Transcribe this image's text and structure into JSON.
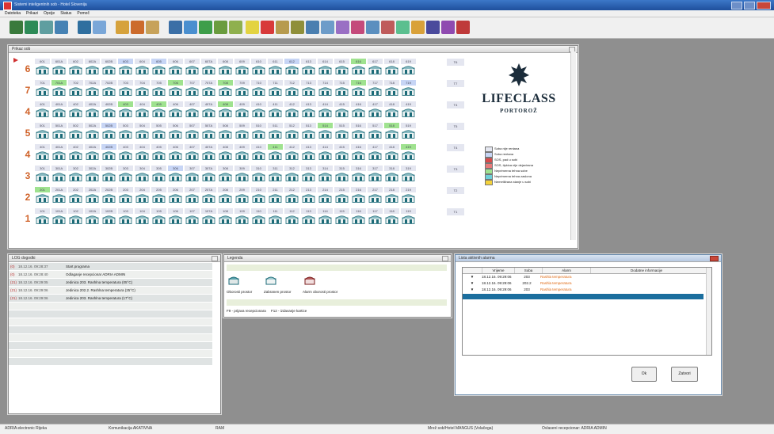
{
  "window": {
    "title": "Sistemi inteligentnih sob - Hotel Slovenija",
    "subtitle": "Prikaz sob"
  },
  "menu": [
    "Datoteka",
    "Prikazi",
    "Opcije",
    "Status",
    "Pomoč"
  ],
  "rooms_window": {
    "title": "Prikaz sob"
  },
  "floors": [
    {
      "label": "6",
      "rooms": [
        "601",
        "601A",
        "602",
        "602A",
        "602B",
        "603",
        "604",
        "605",
        "606",
        "607",
        "607A",
        "608",
        "609",
        "610",
        "611",
        "612",
        "613",
        "614",
        "615",
        "616",
        "617",
        "618",
        "619"
      ],
      "highlight": {
        "603": "#c7d5f5",
        "605": "#c7d5f5",
        "612": "#c7d5f5",
        "616": "#9fe28f"
      },
      "side": "T6"
    },
    {
      "label": "7",
      "rooms": [
        "701",
        "701A",
        "702",
        "702A",
        "702B",
        "703",
        "704",
        "705",
        "706",
        "707",
        "707A",
        "708",
        "709",
        "710",
        "711",
        "712",
        "713",
        "714",
        "715",
        "716",
        "717",
        "718",
        "719"
      ],
      "highlight": {
        "701A": "#9fe28f",
        "706": "#9fe28f",
        "708": "#9fe28f",
        "716": "#9fe28f",
        "719": "#c7d5f5"
      },
      "side": "T7"
    },
    {
      "label": "4",
      "rooms": [
        "401",
        "401A",
        "402",
        "402A",
        "402B",
        "403",
        "404",
        "405",
        "406",
        "407",
        "407A",
        "408",
        "409",
        "410",
        "411",
        "412",
        "413",
        "414",
        "415",
        "416",
        "417",
        "418",
        "419"
      ],
      "highlight": {
        "403": "#9fe28f",
        "405": "#9fe28f",
        "408": "#9fe28f"
      },
      "side": "T4"
    },
    {
      "label": "5",
      "rooms": [
        "501",
        "501A",
        "502",
        "502A",
        "502B",
        "503",
        "504",
        "505",
        "506",
        "507",
        "507A",
        "508",
        "509",
        "510",
        "511",
        "512",
        "513",
        "514",
        "515",
        "516",
        "517",
        "518",
        "519"
      ],
      "highlight": {
        "502B": "#c7d5f5",
        "514": "#9fe28f",
        "518": "#9fe28f"
      },
      "side": "T5"
    },
    {
      "label": "4",
      "rooms": [
        "401",
        "401A",
        "402",
        "402A",
        "402B",
        "403",
        "404",
        "405",
        "406",
        "407",
        "407A",
        "408",
        "409",
        "410",
        "411",
        "412",
        "413",
        "414",
        "415",
        "416",
        "417",
        "418",
        "419"
      ],
      "highlight": {
        "402B": "#c7d5f5",
        "411": "#9fe28f",
        "419": "#9fe28f"
      },
      "side": "T4"
    },
    {
      "label": "3",
      "rooms": [
        "301",
        "301A",
        "302",
        "302A",
        "302B",
        "303",
        "304",
        "305",
        "306",
        "307",
        "307A",
        "308",
        "309",
        "310",
        "311",
        "312",
        "313",
        "314",
        "315",
        "316",
        "317",
        "318",
        "319"
      ],
      "highlight": {
        "306": "#c7d5f5"
      },
      "side": "T3"
    },
    {
      "label": "2",
      "rooms": [
        "201",
        "201A",
        "202",
        "202A",
        "202B",
        "203",
        "204",
        "205",
        "206",
        "207",
        "207A",
        "208",
        "209",
        "210",
        "211",
        "212",
        "213",
        "214",
        "215",
        "216",
        "217",
        "218",
        "219"
      ],
      "highlight": {
        "201": "#9fe28f"
      },
      "side": "T2"
    },
    {
      "label": "1",
      "rooms": [
        "101",
        "101A",
        "102",
        "102A",
        "102B",
        "103",
        "104",
        "105",
        "106",
        "107",
        "107A",
        "108",
        "109",
        "110",
        "111",
        "112",
        "113",
        "114",
        "115",
        "116",
        "117",
        "118",
        "119"
      ],
      "highlight": {},
      "side": "T1"
    }
  ],
  "logo": {
    "name": "LIFECLASS",
    "place": "PORTOROŽ"
  },
  "legend_items": [
    {
      "color": "#e4e6f0",
      "text": "Soba nije rentana"
    },
    {
      "color": "#c7d5f5",
      "text": "Soba rentana"
    },
    {
      "color": "#d94a4a",
      "text": "SOS, pad u sobi"
    },
    {
      "color": "#e87a7a",
      "text": "SOS, tipkica nije dejavirana"
    },
    {
      "color": "#9fe28f",
      "text": "Neprimerna tehna sobe"
    },
    {
      "color": "#6fd0d8",
      "text": "Neprimerna tehna zaslona"
    },
    {
      "color": "#f4d23a",
      "text": "Nemetilirana stanje u sobi"
    }
  ],
  "log_window": {
    "title": "LOG dogodki",
    "rows": [
      {
        "tag": "(0)",
        "time": "18.12.16. 09:28:37",
        "text": "Start programa"
      },
      {
        "tag": "(0)",
        "time": "18.12.16. 09:28:40",
        "text": "Odlaganje recepcionar ADRIA ADMIN"
      },
      {
        "tag": "(21)",
        "time": "18.12.16. 09:29:05",
        "text": "Jedinica 203. Rashlna temperatura (05°C)"
      },
      {
        "tag": "(21)",
        "time": "18.12.16. 09:29:06",
        "text": "Jedinica 202.2. Rashlna temperatura (25°C)"
      },
      {
        "tag": "(21)",
        "time": "18.12.16. 09:29:06",
        "text": "Jedinica 203. Rashlna temperatura (17°C)"
      }
    ]
  },
  "legend_window": {
    "title": "Legenda",
    "items": [
      "Oborosti prostor",
      "Zabranen prostor",
      "Alarm oborosti prostor"
    ],
    "footer": "F9 - prijava recepcionara     F12 - izdavanje kartice"
  },
  "alarms_window": {
    "title": "Lista aktivnih alarma",
    "columns": [
      "Vrijeme",
      "Soba",
      "Alarm",
      "Dodatne informacije"
    ],
    "rows": [
      {
        "time": "18.12.16. 09:29:06",
        "room": "203",
        "alarm": "Rashla temperatura"
      },
      {
        "time": "18.12.16. 09:29:06",
        "room": "202.2",
        "alarm": "Rashla temperatura"
      },
      {
        "time": "18.12.16. 09:29:06",
        "room": "203",
        "alarm": "Rashla temperatura"
      }
    ],
    "ok_label": "Ok",
    "close_label": "Zatvori"
  },
  "status": {
    "server": "ADRIA electronic Rijeka",
    "comm": "Komunikacija AKATIVNA",
    "mode": "RAM",
    "user": "Mrež sob/Hotel MANGUS (Volačega)",
    "receptionist": "Ovlaseni recepcionar: ADRIA ADMIN"
  }
}
